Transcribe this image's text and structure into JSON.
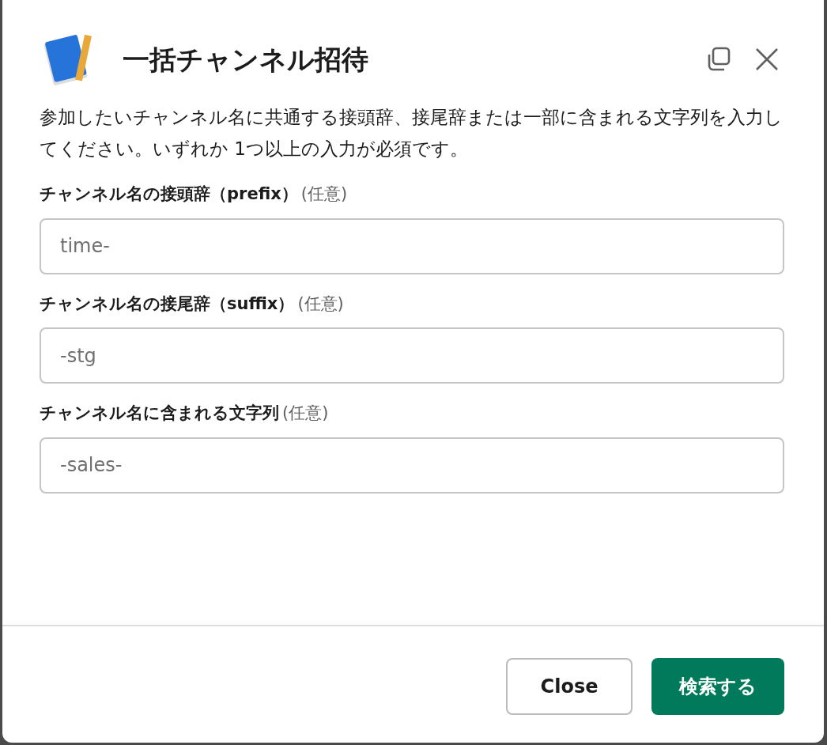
{
  "modal": {
    "title": "一括チャンネル招待"
  },
  "description": "参加したいチャンネル名に共通する接頭辞、接尾辞または一部に含まれる文字列を入力してください。いずれか 1つ以上の入力が必須です。",
  "fields": [
    {
      "label": "チャンネル名の接頭辞（prefix）",
      "hint": "(任意)",
      "placeholder": "time-"
    },
    {
      "label": "チャンネル名の接尾辞（suffix）",
      "hint": "(任意)",
      "placeholder": "-stg"
    },
    {
      "label": "チャンネル名に含まれる文字列",
      "hint": "(任意)",
      "placeholder": "-sales-"
    }
  ],
  "buttons": [
    {
      "label": "Close",
      "kind": "secondary"
    },
    {
      "label": "検索する",
      "kind": "primary"
    }
  ]
}
